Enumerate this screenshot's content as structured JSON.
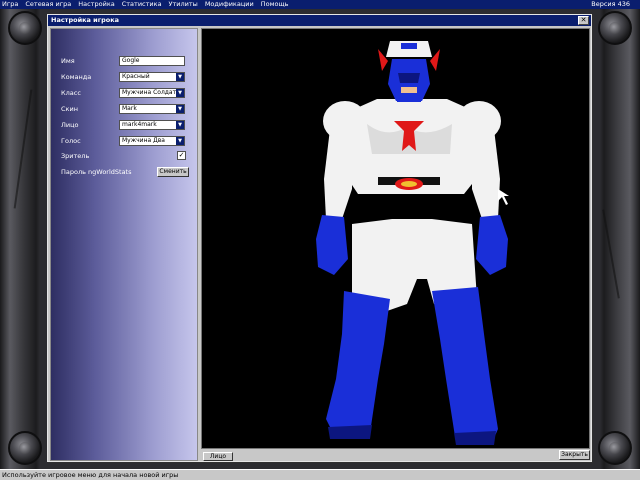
{
  "menu": {
    "items": [
      "Игра",
      "Сетевая игра",
      "Настройка",
      "Статистика",
      "Утилиты",
      "Модификации",
      "Помощь"
    ],
    "version": "Версия 436"
  },
  "dialog": {
    "title": "Настройка игрока",
    "close_glyph": "✕",
    "fields": {
      "name": {
        "label": "Имя",
        "value": "Gogle"
      },
      "team": {
        "label": "Команда",
        "value": "Красный"
      },
      "class": {
        "label": "Класс",
        "value": "Мужчина Солдат"
      },
      "skin": {
        "label": "Скин",
        "value": "Mark"
      },
      "face": {
        "label": "Лицо",
        "value": "mark4mark"
      },
      "voice": {
        "label": "Голос",
        "value": "Мужчина Два"
      },
      "spectator": {
        "label": "Зритель",
        "checked": true,
        "mark": "✓"
      },
      "password": {
        "label": "Пароль ngWorldStats",
        "button": "Сменить"
      }
    },
    "dropdown_arrow": "▼",
    "face_tab": "Лицо",
    "close_button": "Закрыть"
  },
  "status": {
    "text": "Используйте игровое меню для начала новой игры"
  },
  "colors": {
    "titlebar": "#0a1e6e",
    "panel": "#9d9dd0",
    "suit_blue": "#1a2fd8",
    "suit_white": "#f2f2f2",
    "emblem_red": "#e01818"
  }
}
